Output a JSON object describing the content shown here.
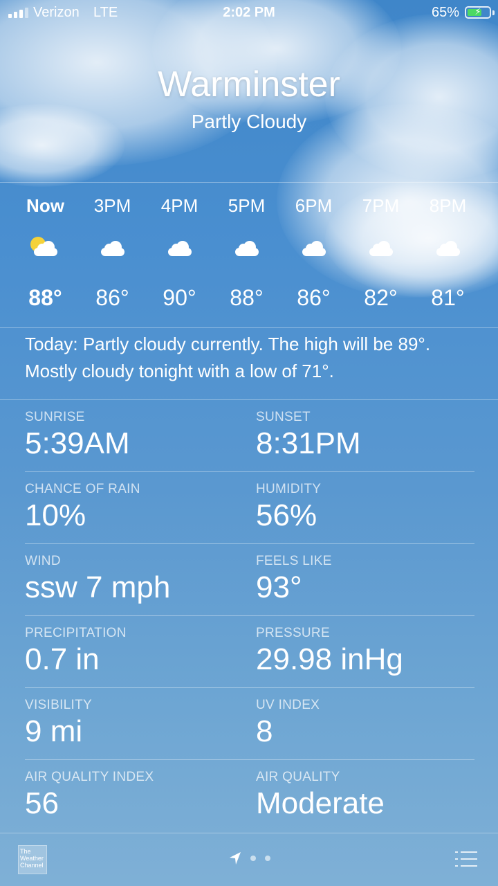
{
  "status_bar": {
    "carrier": "Verizon",
    "network": "LTE",
    "time": "2:02 PM",
    "battery_percent_label": "65%",
    "battery_level": 0.65,
    "signal_bars": 3,
    "battery_color": "#4cd964"
  },
  "header": {
    "city": "Warminster",
    "condition": "Partly Cloudy"
  },
  "hourly": [
    {
      "label": "Now",
      "icon": "partly-sunny-icon",
      "temp": "88°"
    },
    {
      "label": "3PM",
      "icon": "cloud-icon",
      "temp": "86°"
    },
    {
      "label": "4PM",
      "icon": "cloud-icon",
      "temp": "90°"
    },
    {
      "label": "5PM",
      "icon": "cloud-icon",
      "temp": "88°"
    },
    {
      "label": "6PM",
      "icon": "cloud-icon",
      "temp": "86°"
    },
    {
      "label": "7PM",
      "icon": "cloud-icon",
      "temp": "82°"
    },
    {
      "label": "8PM",
      "icon": "cloud-icon",
      "temp": "81°"
    }
  ],
  "summary": "Today: Partly cloudy currently. The high will be 89°. Mostly cloudy tonight with a low of 71°.",
  "details": [
    {
      "left": {
        "label": "SUNRISE",
        "value": "5:39AM"
      },
      "right": {
        "label": "SUNSET",
        "value": "8:31PM"
      }
    },
    {
      "left": {
        "label": "CHANCE OF RAIN",
        "value": "10%"
      },
      "right": {
        "label": "HUMIDITY",
        "value": "56%"
      }
    },
    {
      "left": {
        "label": "WIND",
        "value": "ssw 7 mph"
      },
      "right": {
        "label": "FEELS LIKE",
        "value": "93°"
      }
    },
    {
      "left": {
        "label": "PRECIPITATION",
        "value": "0.7 in"
      },
      "right": {
        "label": "PRESSURE",
        "value": "29.98 inHg"
      }
    },
    {
      "left": {
        "label": "VISIBILITY",
        "value": "9 mi"
      },
      "right": {
        "label": "UV INDEX",
        "value": "8"
      }
    },
    {
      "left": {
        "label": "AIR QUALITY INDEX",
        "value": "56"
      },
      "right": {
        "label": "AIR QUALITY",
        "value": "Moderate"
      }
    }
  ],
  "bottom_bar": {
    "logo_text": "The Weather Channel",
    "page_count": 3,
    "current_page": 1,
    "location_icon": "location-arrow-icon",
    "list_icon": "list-icon"
  }
}
